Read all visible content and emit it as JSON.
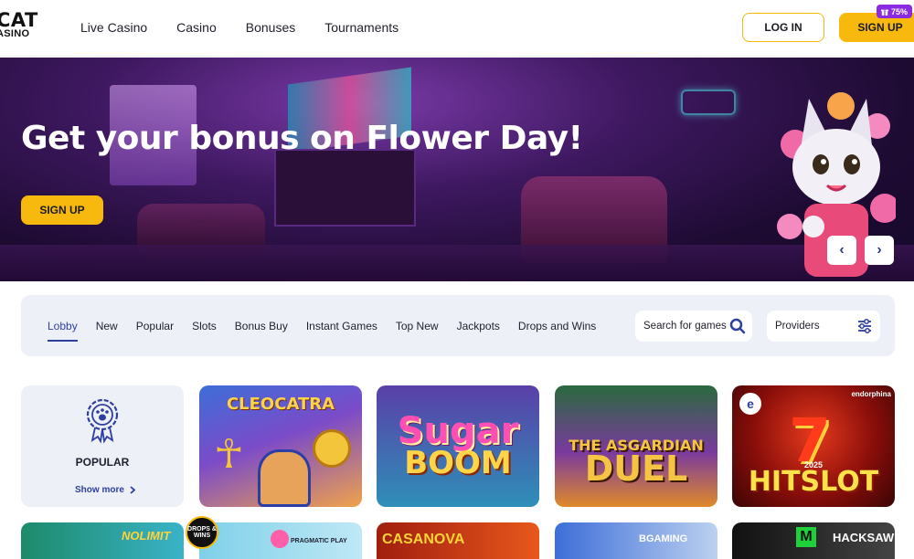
{
  "header": {
    "logo_line1": "CAT",
    "logo_line2": "ASINO",
    "nav": [
      "Live Casino",
      "Casino",
      "Bonuses",
      "Tournaments"
    ],
    "login_label": "LOG IN",
    "signup_label": "SIGN UP",
    "promo_badge": "75%",
    "promo_icon": "gift-icon"
  },
  "hero": {
    "title": "Get your bonus on Flower Day!",
    "cta_label": "SIGN UP",
    "prev_label": "‹",
    "next_label": "›"
  },
  "tabs": {
    "items": [
      "Lobby",
      "New",
      "Popular",
      "Slots",
      "Bonus Buy",
      "Instant Games",
      "Top New",
      "Jackpots",
      "Drops and Wins"
    ],
    "active": "Lobby",
    "search_placeholder": "Search for games",
    "providers_label": "Providers"
  },
  "popular_card": {
    "title": "POPULAR",
    "more_label": "Show more",
    "icon": "paw-badge-icon"
  },
  "games": [
    {
      "title": "CLEOCATRA"
    },
    {
      "title": "Sugar",
      "subtitle": "BOOM"
    },
    {
      "title": "THE ASGARDIAN",
      "subtitle": "DUEL"
    },
    {
      "year": "2025",
      "title": "HITSLOT",
      "provider": "endorphina"
    }
  ],
  "games_row2": [
    {
      "label": "NOLIMIT"
    },
    {
      "label": "PRAGMATIC PLAY",
      "badge": "DROPS & WINS"
    },
    {
      "label": "CASANOVA"
    },
    {
      "label": "BGAMING"
    },
    {
      "label": "HACKSAW"
    }
  ],
  "colors": {
    "accent_yellow": "#f7b90d",
    "accent_blue": "#2e3f9e",
    "promo_purple": "#8a2be2",
    "panel_bg": "#eef0f8"
  }
}
